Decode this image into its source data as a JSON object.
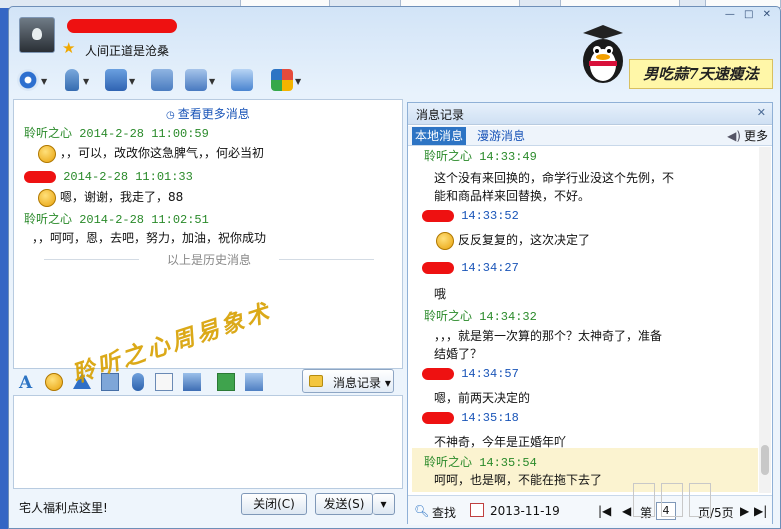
{
  "window": {
    "signature": "人间正道是沧桑",
    "ad_text": "男吃蒜7天速瘦法",
    "controls": "— □ ✕"
  },
  "chat": {
    "more_link": "查看更多消息",
    "history_divider": "以上是历史消息",
    "lines": [
      {
        "kind": "meta",
        "text": "聆听之心 2014-2-28 11:00:59"
      },
      {
        "kind": "body",
        "text": "，，可以，改改你这急脾气，，何必当初",
        "emoji": true
      },
      {
        "kind": "meta",
        "text": "2014-2-28 11:01:33",
        "redacted": true
      },
      {
        "kind": "body",
        "text": "嗯，谢谢，我走了，88",
        "emoji": true
      },
      {
        "kind": "meta",
        "text": "聆听之心 2014-2-28 11:02:51"
      },
      {
        "kind": "body",
        "text": "，，呵呵，恩，去吧，努力，加油，祝你成功"
      }
    ]
  },
  "format_toolbar": {
    "font_icon": "A",
    "history_button": "消息记录"
  },
  "watermark": "聆听之心周易象术",
  "footer": {
    "note": "宅人福利点这里!",
    "close": "关闭(C)",
    "send": "发送(S)"
  },
  "history": {
    "title": "消息记录",
    "tab_local": "本地消息",
    "tab_roam": "漫游消息",
    "more": "更多",
    "entries": [
      {
        "kind": "meta",
        "text": "聆听之心 14:33:49"
      },
      {
        "kind": "body",
        "text": "这个没有来回换的，命学行业没这个先例，不"
      },
      {
        "kind": "body",
        "text": "能和商品样来回替换，不好。"
      },
      {
        "kind": "meta",
        "text": "14:33:52",
        "redacted": true
      },
      {
        "kind": "body",
        "text": "反反复复的，这次决定了",
        "emoji": true
      },
      {
        "kind": "meta",
        "text": "14:34:27",
        "redacted": true
      },
      {
        "kind": "body",
        "text": "哦"
      },
      {
        "kind": "meta",
        "text": "聆听之心 14:34:32"
      },
      {
        "kind": "body",
        "text": "，，，就是第一次算的那个？太神奇了，准备"
      },
      {
        "kind": "body",
        "text": "结婚了？"
      },
      {
        "kind": "meta",
        "text": "14:34:57",
        "redacted": true
      },
      {
        "kind": "body",
        "text": "嗯，前两天决定的"
      },
      {
        "kind": "meta",
        "text": "14:35:18",
        "redacted": true
      },
      {
        "kind": "body",
        "text": "不神奇，今年是正婚年吖"
      },
      {
        "kind": "meta",
        "text": "聆听之心 14:35:54"
      },
      {
        "kind": "body",
        "text": "呵呵，也是啊，不能在拖下去了"
      }
    ],
    "footer": {
      "search": "查找",
      "date": "2013-11-19",
      "page_prefix": "第",
      "page": "4",
      "page_suffix": "页/5页"
    }
  },
  "colors": {
    "meta_green": "#2a8a2a",
    "link_blue": "#1a55b8",
    "highlight": "#fbf3d0"
  }
}
